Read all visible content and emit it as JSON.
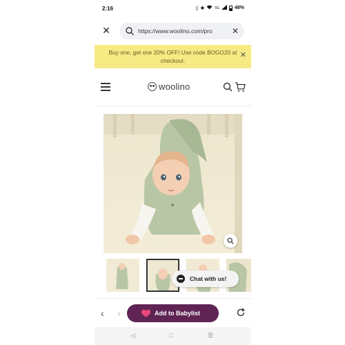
{
  "status": {
    "time": "2:16",
    "battery": "48%",
    "icons": [
      "vibrate-icon",
      "bluetooth-icon",
      "wifi-icon",
      "5g-icon",
      "signal-icon",
      "battery-icon"
    ]
  },
  "browser": {
    "url": "https://www.woolino.com/pro",
    "close_icon": "close-icon",
    "clear_icon": "clear-icon"
  },
  "promo": {
    "text": "Buy one, get one 20% OFF! Use code BOGO20 at checkout."
  },
  "header": {
    "logo_text": "woolino",
    "menu_icon": "hamburger-icon",
    "search_icon": "search-icon",
    "cart_icon": "cart-icon"
  },
  "product": {
    "zoom_icon": "zoom-icon",
    "thumbnails_count_visible": 4,
    "active_thumbnail": 2
  },
  "chat": {
    "label": "Chat with us!"
  },
  "toolbar": {
    "babylist_label": "Add to Babylist",
    "back_icon": "chevron-left-icon",
    "forward_icon": "chevron-right-icon",
    "refresh_icon": "refresh-icon"
  },
  "nav": {
    "back": "◁",
    "home": "□",
    "recents": "☰"
  },
  "colors": {
    "promo_bg": "#f6ea85",
    "babylist_purple": "#5f2454",
    "heart_pink": "#e8477c"
  }
}
